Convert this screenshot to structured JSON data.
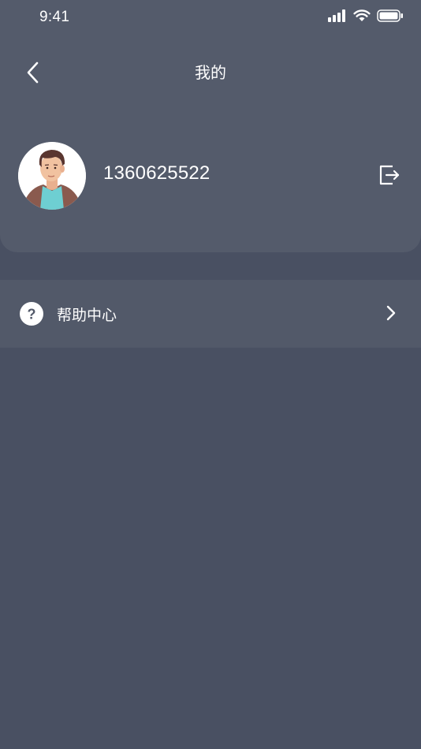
{
  "status_bar": {
    "time": "9:41",
    "icons": [
      "cellular-signal-icon",
      "wifi-icon",
      "battery-icon"
    ]
  },
  "nav": {
    "back_icon": "chevron-left-icon",
    "title": "我的"
  },
  "profile": {
    "avatar": "user-avatar",
    "phone": "1360625522",
    "logout_icon": "logout-icon"
  },
  "menu": {
    "items": [
      {
        "icon": "question-circle-icon",
        "label": "帮助中心",
        "chevron": "chevron-right-icon"
      }
    ]
  },
  "colors": {
    "background": "#495062",
    "card": "#545b6b",
    "menu_row": "#525969",
    "text": "#ffffff"
  }
}
